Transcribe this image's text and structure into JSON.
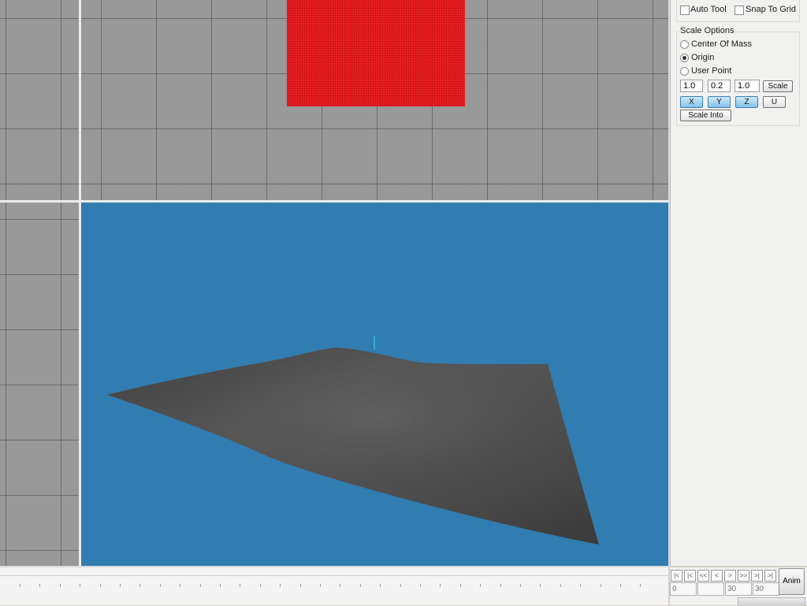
{
  "panel": {
    "options": {
      "auto_tool": "Auto Tool",
      "snap_to_grid": "Snap To Grid"
    },
    "scale_options": {
      "title": "Scale Options",
      "center_of_mass": "Center Of Mass",
      "origin": "Origin",
      "user_point": "User Point",
      "selected": "Origin",
      "x_value": "1.0",
      "y_value": "0.2",
      "z_value": "1.0",
      "scale_button": "Scale",
      "axis_x": "X",
      "axis_y": "Y",
      "axis_z": "Z",
      "axis_u": "U",
      "scale_into_button": "Scale Into"
    }
  },
  "timeline": {
    "start_frame": "0",
    "current_frame": "",
    "end_frame": "30",
    "total_frames": "30",
    "anim_button": "Anim",
    "controls": [
      "|<",
      "|<",
      "<<",
      "<",
      ">",
      ">>",
      ">|",
      ">|"
    ]
  },
  "colors": {
    "viewport_grid_bg": "#999999",
    "viewport_3d_bg": "#317cb1",
    "selected_object": "#e81e22",
    "mesh": "#4a4a4a",
    "axis_button_active": "#84c2e8"
  }
}
